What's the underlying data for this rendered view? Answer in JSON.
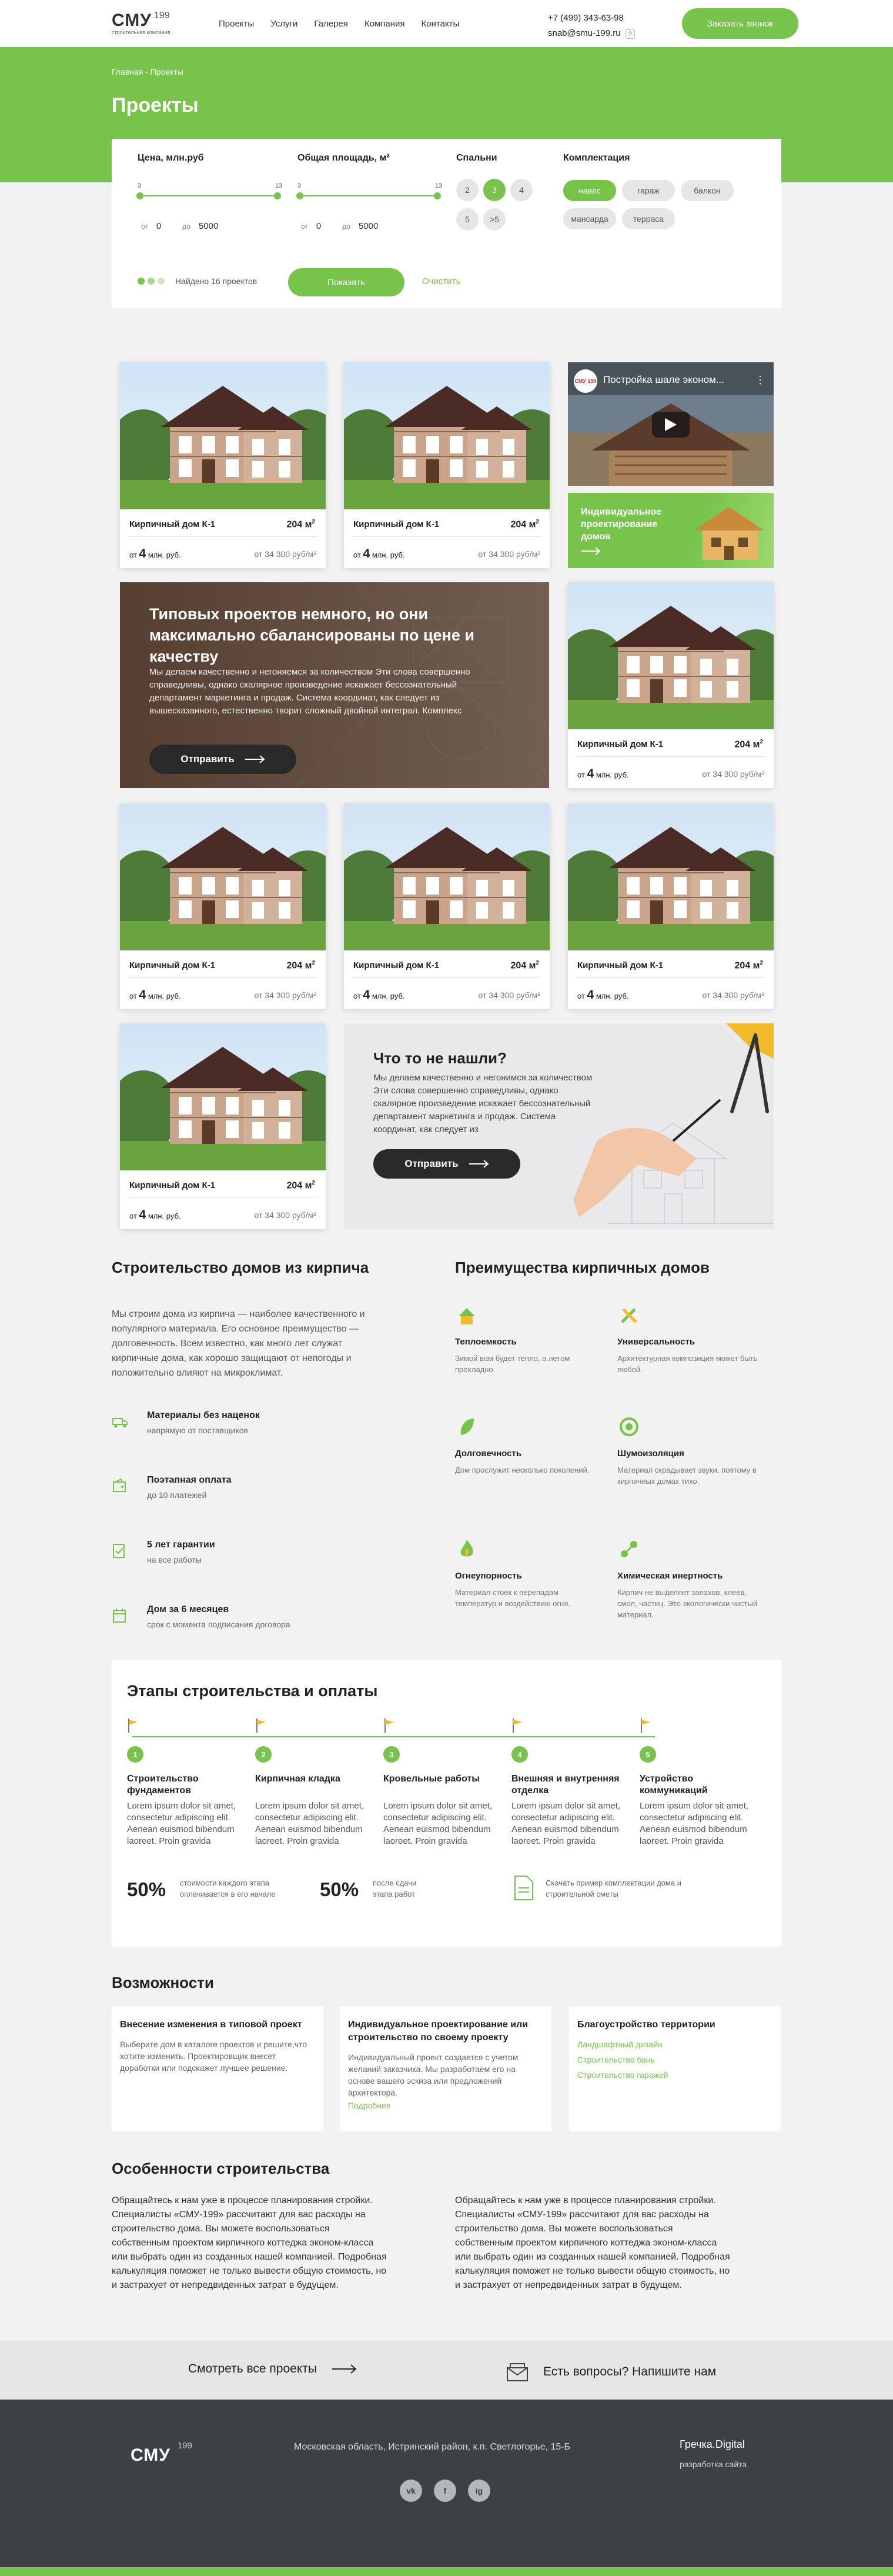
{
  "header": {
    "logo_name": "СМУ",
    "logo_num": "199",
    "logo_sub": "строительная компания",
    "nav": [
      "Проекты",
      "Услуги",
      "Галерея",
      "Компания",
      "Контакты"
    ],
    "phone": "+7 (499) 343-63-98",
    "email": "snab@smu-199.ru",
    "help": "?",
    "order_btn": "Заказать звонок"
  },
  "hero": {
    "breadcrumb": "Главная - Проекты",
    "title": "Проекты"
  },
  "filter": {
    "price_label": "Цена, млн.руб",
    "area_label": "Общая площадь, м²",
    "bedrooms_label": "Спальни",
    "config_label": "Комплектация",
    "price_min_mark": "3",
    "price_max_mark": "13",
    "area_min_mark": "3",
    "area_max_mark": "13",
    "from": "от",
    "to": "до",
    "price_from": "0",
    "price_to": "5000",
    "area_from": "0",
    "area_to": "5000",
    "bedrooms": [
      "2",
      "3",
      "4",
      "5",
      ">5"
    ],
    "config": [
      "навес",
      "гараж",
      "балкон",
      "мансарда",
      "терраса"
    ],
    "found": "Найдено 16 проектов",
    "show_btn": "Показать",
    "clear": "Очистить"
  },
  "card": {
    "title": "Кирпичный дом К-1",
    "area": "204 м",
    "area_sup": "2",
    "price_prefix": "от",
    "price_value": "4",
    "price_unit": "млн. руб.",
    "price_per_m": "от 34 300 руб/м²"
  },
  "banner_typical": {
    "title": "Типовых проектов немного, но они максимально сбалансированы по цене и качеству",
    "desc": "Мы делаем качественно и негоняемся за количеством Эти слова совершенно справедливы, однако скалярное произведение искажает бессознательный департамент маркетинга и продаж. Система координат, как следует из вышесказанного, естественно творит сложный двойной интеграл. Комплекс",
    "btn": "Отправить"
  },
  "video": {
    "title": "Постройка шале эконом...",
    "channel": "СМУ 199",
    "menu": "⋮"
  },
  "individual": {
    "title": "Индивидуальное проектирование домов"
  },
  "banner_notfound": {
    "title": "Что то не нашли?",
    "desc": "Мы делаем качественно и негонимся за количеством Эти слова совершенно справедливы, однако скалярное произведение искажает бессознательный департамент маркетинга и продаж. Система координат, как следует из",
    "btn": "Отправить"
  },
  "brick": {
    "title": "Строительство домов из кирпича",
    "intro": "Мы строим дома из кирпича — наиболее качественного и популярного материала. Его основное преимущество — долговечность. Всем известно, как много лет служат кирпичные дома, как хорошо защищают от непогоды и положительно влияют на микроклимат.",
    "features": [
      {
        "h": "Материалы без наценок",
        "s": "напрямую от поставщиков"
      },
      {
        "h": "Поэтапная оплата",
        "s": "до 10 платежей"
      },
      {
        "h": "5 лет гарантии",
        "s": "на все работы"
      },
      {
        "h": "Дом за 6 месяцев",
        "s": "срок с момента подписания договора"
      }
    ]
  },
  "advantages": {
    "title": "Преимущества кирпичных домов",
    "items": [
      {
        "h": "Теплоемкость",
        "s": "Зимой вам будет тепло, а летом прохладно."
      },
      {
        "h": "Универсальность",
        "s": "Архитектурная композиция может быть любой."
      },
      {
        "h": "Долговечность",
        "s": "Дом прослужит несколько поколений."
      },
      {
        "h": "Шумоизоляция",
        "s": "Материал скрадывает звуки, поэтому в кирпичных домах тихо."
      },
      {
        "h": "Огнеупорность",
        "s": "Материал стоек к перепадам температур и воздействию огня."
      },
      {
        "h": "Химическая инертность",
        "s": "Кирпич не выделяет запахов, клеев, смол, частиц. Это экологически чистый материал."
      }
    ]
  },
  "stages": {
    "title": "Этапы строительства и оплаты",
    "items": [
      {
        "n": "1",
        "h": "Строительство фундаментов",
        "d": "Lorem ipsum dolor sit amet, consectetur adipiscing elit. Aenean euismod bibendum laoreet. Proin gravida"
      },
      {
        "n": "2",
        "h": "Кирпичная кладка",
        "d": "Lorem ipsum dolor sit amet, consectetur adipiscing elit. Aenean euismod bibendum laoreet. Proin gravida"
      },
      {
        "n": "3",
        "h": "Кровельные работы",
        "d": "Lorem ipsum dolor sit amet, consectetur adipiscing elit. Aenean euismod bibendum laoreet. Proin gravida"
      },
      {
        "n": "4",
        "h": "Внешняя и внутренняя отделка",
        "d": "Lorem ipsum dolor sit amet, consectetur adipiscing elit. Aenean euismod bibendum laoreet. Proin gravida"
      },
      {
        "n": "5",
        "h": "Устройство коммуникаций",
        "d": "Lorem ipsum dolor sit amet, consectetur adipiscing elit. Aenean euismod bibendum laoreet. Proin gravida"
      }
    ],
    "pct1": "50%",
    "pct1_desc": "стоимости каждого этапа оплачивается в его начале",
    "pct2": "50%",
    "pct2_desc": "после сдачи этапа работ",
    "download": "Скачать пример комплектации дома и строительной сметы"
  },
  "possibilities": {
    "title": "Возможности",
    "cards": [
      {
        "h": "Внесение изменения в типовой проект",
        "d": "Выберите дом в каталоге проектов и решите,что хотите изменить. Проектировщик внесет доработки или подскажет лучшее решение."
      },
      {
        "h": "Индивидуальное проектирование или строительство по своему проекту",
        "d": "Индивидуальный проект создается с учетом желаний заказчика. Мы разработаем его на основе вашего эскиза или предложений архитектора.",
        "link": "Подробнее"
      },
      {
        "h": "Благоустройство территории",
        "links": [
          "Ландшафтный дизайн",
          "Строительство бань",
          "Строительство гаражей"
        ]
      }
    ]
  },
  "features_section": {
    "title": "Особенности строительства",
    "p1": "Обращайтесь к нам уже в процессе планирования стройки. Специалисты «СМУ-199» рассчитают для вас расходы на строительство дома. Вы можете воспользоваться собственным проектом кирпичного коттеджа эконом-класса или выбрать один из созданных нашей компанией. Подробная калькуляция поможет не только вывести общую стоимость, но и застрахует от непредвиденных затрат в будущем.",
    "p2": "Обращайтесь к нам уже в процессе планирования стройки. Специалисты «СМУ-199» рассчитают для вас расходы на строительство дома. Вы можете воспользоваться собственным проектом кирпичного коттеджа эконом-класса или выбрать один из созданных нашей компанией. Подробная калькуляция поможет не только вывести общую стоимость, но и застрахует от непредвиденных затрат в будущем."
  },
  "bottom": {
    "see_all": "Смотреть все проекты",
    "question": "Есть вопросы? Напишите нам"
  },
  "footer": {
    "logo_name": "СМУ",
    "logo_num": "199",
    "address": "Московская область, Истринский район, к.п. Светлогорье, 15-Б",
    "dev": "Гречка.Digital",
    "dev_sub": "разработка сайта",
    "socials": [
      "vk",
      "f",
      "ig"
    ]
  },
  "colors": {
    "accent": "#77c34c",
    "dark": "#2a2a2a",
    "footer": "#3d4044"
  }
}
